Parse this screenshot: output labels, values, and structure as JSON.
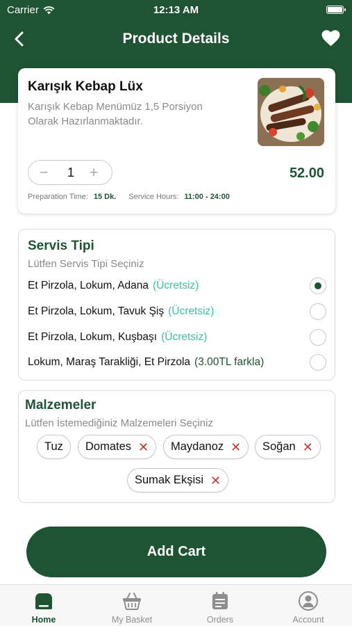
{
  "status_bar": {
    "carrier": "Carrier",
    "time": "12:13 AM"
  },
  "nav": {
    "title": "Product Details",
    "back_icon": "chevron-left-icon",
    "favorite_icon": "heart-icon"
  },
  "product": {
    "name": "Karışık Kebap Lüx",
    "description": "Karışık Kebap Menümüz 1,5 Porsiyon Olarak Hazırlanmaktadır.",
    "quantity": "1",
    "price": "52.00",
    "prep_label": "Preparation Time:",
    "prep_value": "15 Dk.",
    "service_label": "Service Hours:",
    "service_value": "11:00 - 24:00"
  },
  "servis": {
    "title": "Servis Tipi",
    "subtitle": "Lütfen Servis Tipi Seçiniz",
    "options": [
      {
        "label": "Et Pirzola, Lokum, Adana",
        "extra": "(Ücretsiz)",
        "selected": true
      },
      {
        "label": "Et Pirzola, Lokum, Tavuk Şiş",
        "extra": "(Ücretsiz)",
        "selected": false
      },
      {
        "label": "Et Pirzola, Lokum, Kuşbaşı",
        "extra": "(Ücretsiz)",
        "selected": false
      },
      {
        "label": "Lokum, Maraş Tarakliği, Et Pirzola",
        "extra": "(3.00TL farkla)",
        "selected": false
      }
    ]
  },
  "malzemeler": {
    "title": "Malzemeler",
    "subtitle": "Lütfen İstemediğiniz Malzemeleri Seçiniz",
    "chips": [
      {
        "label": "Tuz",
        "removable": false
      },
      {
        "label": "Domates",
        "removable": true
      },
      {
        "label": "Maydanoz",
        "removable": true
      },
      {
        "label": "Soğan",
        "removable": true
      },
      {
        "label": "Sumak Ekşisi",
        "removable": true
      }
    ],
    "remove_glyph": "✕"
  },
  "actions": {
    "add_cart": "Add Cart"
  },
  "tabs": [
    {
      "label": "Home",
      "icon": "home-icon",
      "active": true
    },
    {
      "label": "My Basket",
      "icon": "basket-icon",
      "active": false
    },
    {
      "label": "Orders",
      "icon": "orders-icon",
      "active": false
    },
    {
      "label": "Account",
      "icon": "account-icon",
      "active": false
    }
  ],
  "colors": {
    "primary": "#1e5433",
    "free_tag": "#3cc1a6",
    "remove": "#c0392b"
  }
}
